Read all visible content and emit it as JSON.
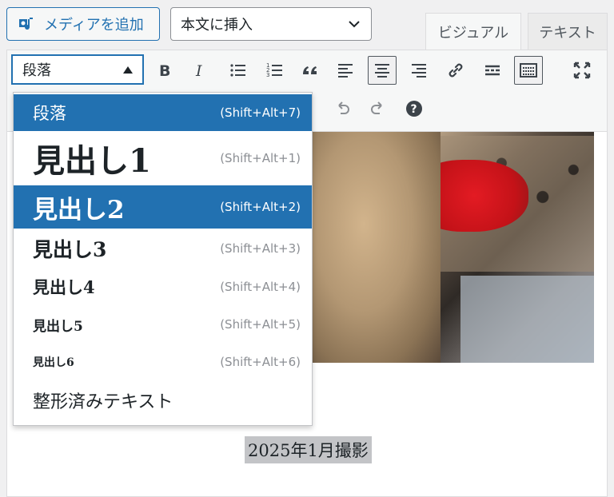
{
  "header": {
    "add_media_label": "メディアを追加",
    "insert_select_value": "本文に挿入",
    "tab_visual": "ビジュアル",
    "tab_text": "テキスト"
  },
  "toolbar": {
    "format_value": "段落",
    "buttons": [
      "bold",
      "italic",
      "bulleted-list",
      "numbered-list",
      "blockquote",
      "align-left",
      "align-center",
      "align-right",
      "link",
      "read-more",
      "toolbar-toggle",
      "fullscreen"
    ],
    "row2": [
      "undo",
      "redo",
      "help"
    ]
  },
  "dropdown": {
    "items": [
      {
        "label": "段落",
        "shortcut": "(Shift+Alt+7)",
        "selected": true
      },
      {
        "label": "見出し1",
        "shortcut": "(Shift+Alt+1)",
        "selected": false
      },
      {
        "label": "見出し2",
        "shortcut": "(Shift+Alt+2)",
        "selected": true
      },
      {
        "label": "見出し3",
        "shortcut": "(Shift+Alt+3)",
        "selected": false
      },
      {
        "label": "見出し4",
        "shortcut": "(Shift+Alt+4)",
        "selected": false
      },
      {
        "label": "見出し5",
        "shortcut": "(Shift+Alt+5)",
        "selected": false
      },
      {
        "label": "見出し6",
        "shortcut": "(Shift+Alt+6)",
        "selected": false
      },
      {
        "label": "整形済みテキスト",
        "shortcut": "",
        "selected": false
      }
    ]
  },
  "content": {
    "caption": "2025年1月撮影"
  },
  "colors": {
    "accent": "#2271b1",
    "toolbar_bg": "#f6f7f7",
    "shortcut_gray": "#8c8f94"
  }
}
